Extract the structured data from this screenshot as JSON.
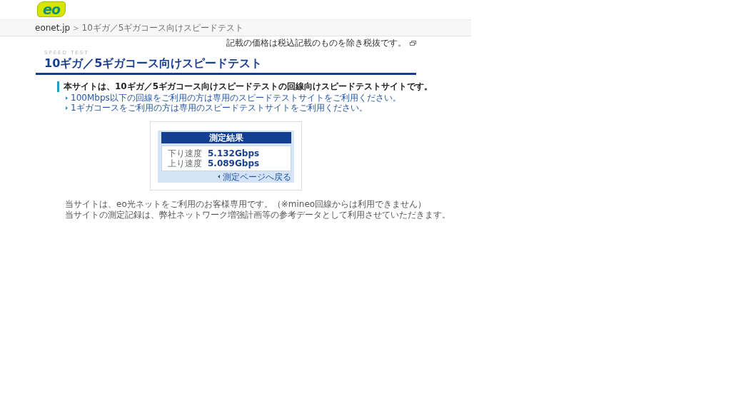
{
  "header": {
    "logo": "eo"
  },
  "breadcrumb": {
    "separator": ">",
    "items": [
      {
        "label": "eonet.jp",
        "current": false
      },
      {
        "label": "10ギガ／5ギガコース向けスピードテスト",
        "current": true
      }
    ]
  },
  "tax_note": "記載の価格は税込記載のものを除き税抜です。",
  "page": {
    "eyebrow": "SPEED TEST",
    "title": "10ギガ／5ギガコース向けスピードテスト"
  },
  "notice": {
    "lead": "本サイトは、10ギガ／5ギガコース向けスピードテストの回線向けスピードテストサイトです。",
    "links": [
      "100Mbps以下の回線をご利用の方は専用のスピードテストサイトをご利用ください。",
      "1ギガコースをご利用の方は専用のスピードテストサイトをご利用ください。"
    ]
  },
  "result": {
    "title": "測定結果",
    "rows": [
      {
        "label": "下り速度",
        "value": "5.132Gbps"
      },
      {
        "label": "上り速度",
        "value": "5.089Gbps"
      }
    ],
    "back_link": "測定ページへ戻る"
  },
  "notes": [
    "当サイトは、eo光ネットをご利用のお客様専用です。（※mineo回線からは利用できません）",
    "当サイトの測定記録は、弊社ネットワーク増強計画等の参考データとして利用させていただきます。"
  ]
}
